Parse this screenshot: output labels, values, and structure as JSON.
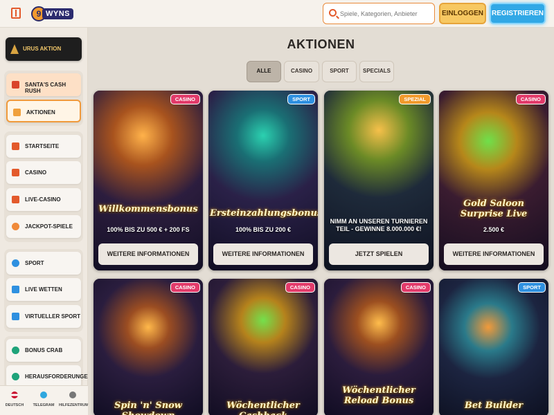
{
  "header": {
    "logo_text": "WYNS",
    "search_placeholder": "Spiele, Kategorien, Anbieter",
    "login_label": "EINLOGGEN",
    "register_label": "REGISTRIEREN"
  },
  "sidebar": {
    "top_label": "URUS AKTION",
    "promo_items": [
      {
        "label": "SANTA'S CASH RUSH",
        "icon": "santa-icon"
      },
      {
        "label": "AKTIONEN",
        "icon": "gift-icon"
      }
    ],
    "casino_items": [
      {
        "label": "STARTSEITE",
        "icon": "home-icon"
      },
      {
        "label": "CASINO",
        "icon": "cards-icon"
      },
      {
        "label": "LIVE-CASINO",
        "icon": "live-casino-icon"
      },
      {
        "label": "JACKPOT-SPIELE",
        "icon": "jackpot-icon"
      }
    ],
    "sport_items": [
      {
        "label": "SPORT",
        "icon": "ball-icon"
      },
      {
        "label": "LIVE WETTEN",
        "icon": "live-icon"
      },
      {
        "label": "VIRTUELLER SPORT",
        "icon": "virtual-sport-icon"
      }
    ],
    "extra_items": [
      {
        "label": "BONUS CRAB",
        "icon": "crab-icon"
      },
      {
        "label": "HERAUSFORDERUNGEN",
        "icon": "medal-icon"
      }
    ],
    "footer": [
      {
        "label": "DEUTSCH",
        "icon": "flag-de-icon"
      },
      {
        "label": "TELEGRAM",
        "icon": "telegram-icon"
      },
      {
        "label": "HILFEZENTRUM",
        "icon": "help-icon"
      }
    ]
  },
  "main": {
    "title": "AKTIONEN",
    "tabs": [
      "ALLE",
      "CASINO",
      "SPORT",
      "SPECIALS"
    ],
    "cards": [
      {
        "badge": "CASINO",
        "name": "Willkommensbonus",
        "sub": "100% BIS ZU 500 € + 200 FS",
        "cta": "WEITERE INFORMATIONEN"
      },
      {
        "badge": "SPORT",
        "name": "Ersteinzahlungsbonus",
        "sub": "100% BIS ZU 200 €",
        "cta": "WEITERE INFORMATIONEN"
      },
      {
        "badge": "SPEZIAL",
        "name": "",
        "sub": "NIMM AN UNSEREN TURNIEREN TEIL - GEWINNE 8.000.000 €!",
        "cta": "JETZT SPIELEN"
      },
      {
        "badge": "CASINO",
        "name": "Gold Saloon Surprise Live",
        "sub": "2.500 €",
        "cta": "WEITERE INFORMATIONEN"
      },
      {
        "badge": "CASINO",
        "name": "Spin 'n' Snow Showdown",
        "sub": "",
        "cta": ""
      },
      {
        "badge": "CASINO",
        "name": "Wöchentlicher Cashback",
        "sub": "",
        "cta": ""
      },
      {
        "badge": "CASINO",
        "name": "Wöchentlicher Reload Bonus",
        "sub": "",
        "cta": ""
      },
      {
        "badge": "SPORT",
        "name": "Bet Builder",
        "sub": "",
        "cta": ""
      }
    ]
  },
  "colors": {
    "accent": "#f09a3c",
    "register": "#31a8e6",
    "login": "#f7c862",
    "casino_badge": "#e23a6a",
    "sport_badge": "#2e90e0",
    "spezial_badge": "#f29a2c"
  }
}
